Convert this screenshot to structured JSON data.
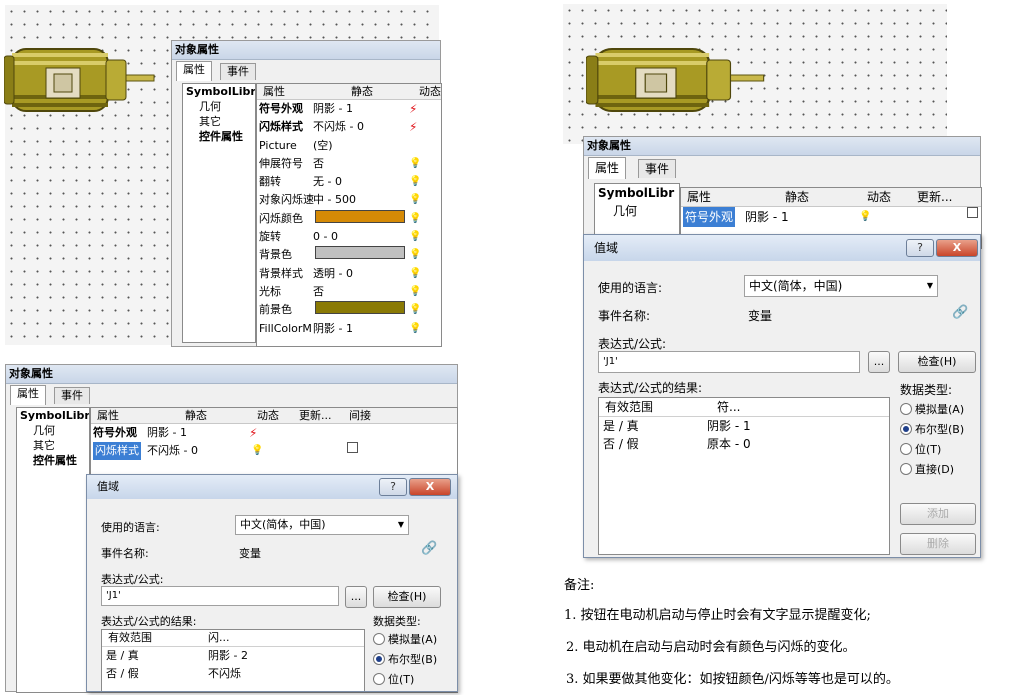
{
  "window_title": "对象属性",
  "tabs": [
    "属性",
    "事件"
  ],
  "tree": {
    "root": "SymbolLibr",
    "items": [
      "几何",
      "其它",
      "控件属性"
    ]
  },
  "prop_headers": [
    "属性",
    "静态",
    "动态",
    "更新...",
    "间接"
  ],
  "properties": [
    {
      "name": "符号外观",
      "value": "阴影 - 1",
      "dynamic": "bolt"
    },
    {
      "name": "闪烁样式",
      "value": "不闪烁 - 0",
      "dynamic": "bolt"
    },
    {
      "name": "Picture",
      "value": "(空)",
      "dynamic": ""
    },
    {
      "name": "伸展符号",
      "value": "否",
      "dynamic": "bulb"
    },
    {
      "name": "翻转",
      "value": "无 - 0",
      "dynamic": "bulb"
    },
    {
      "name": "对象闪烁速",
      "value": "中 - 500",
      "dynamic": "bulb"
    },
    {
      "name": "闪烁颜色",
      "value": "",
      "color": "#d58a06",
      "dynamic": "bulb"
    },
    {
      "name": "旋转",
      "value": "0 - 0",
      "dynamic": "bulb"
    },
    {
      "name": "背景色",
      "value": "",
      "color": "#c0c0c0",
      "dynamic": "bulb"
    },
    {
      "name": "背景样式",
      "value": "透明 - 0",
      "dynamic": "bulb"
    },
    {
      "name": "光标",
      "value": "否",
      "dynamic": "bulb"
    },
    {
      "name": "前景色",
      "value": "",
      "color": "#8a7a05",
      "dynamic": "bulb"
    },
    {
      "name": "FillColorM",
      "value": "阴影 - 1",
      "dynamic": "bulb"
    }
  ],
  "dialog": {
    "title": "值域",
    "lang_label": "使用的语言:",
    "lang_value": "中文(简体，中国)",
    "event_label": "事件名称:",
    "event_value": "变量",
    "expr_label": "表达式/公式:",
    "expr_value": "'J1'",
    "browse": "...",
    "check": "检查(H)",
    "result_label": "表达式/公式的结果:",
    "list_headers": [
      "有效范围",
      "符..."
    ],
    "list_headers_short": [
      "有效范围",
      "闪..."
    ],
    "dtype_label": "数据类型:",
    "dtypes": [
      "模拟量(A)",
      "布尔型(B)",
      "位(T)",
      "直接(D)"
    ],
    "add": "添加",
    "delete": "删除",
    "help": "?",
    "close": "X"
  },
  "bottom_left": {
    "row1": {
      "name": "符号外观",
      "value": "阴影 - 1"
    },
    "row2": {
      "name": "闪烁样式",
      "value": "不闪烁 - 0"
    },
    "results": [
      {
        "range": "是 / 真",
        "value": "阴影 - 2"
      },
      {
        "range": "否 / 假",
        "value": "不闪烁"
      }
    ]
  },
  "right": {
    "row1": {
      "name": "符号外观",
      "value": "阴影 - 1"
    },
    "results": [
      {
        "range": "是 / 真",
        "value": "阴影 - 1"
      },
      {
        "range": "否 / 假",
        "value": "原本 - 0"
      }
    ]
  },
  "notes": {
    "title": "备注:",
    "items": [
      "1. 按钮在电动机启动与停止时会有文字显示提醒变化;",
      "2. 电动机在启动与启动时会有颜色与闪烁的变化。",
      "3. 如果要做其他变化：如按钮颜色/闪烁等等也是可以的。"
    ]
  },
  "colors": {
    "motor": "#a89a24",
    "accent": "#3c7fd4"
  }
}
